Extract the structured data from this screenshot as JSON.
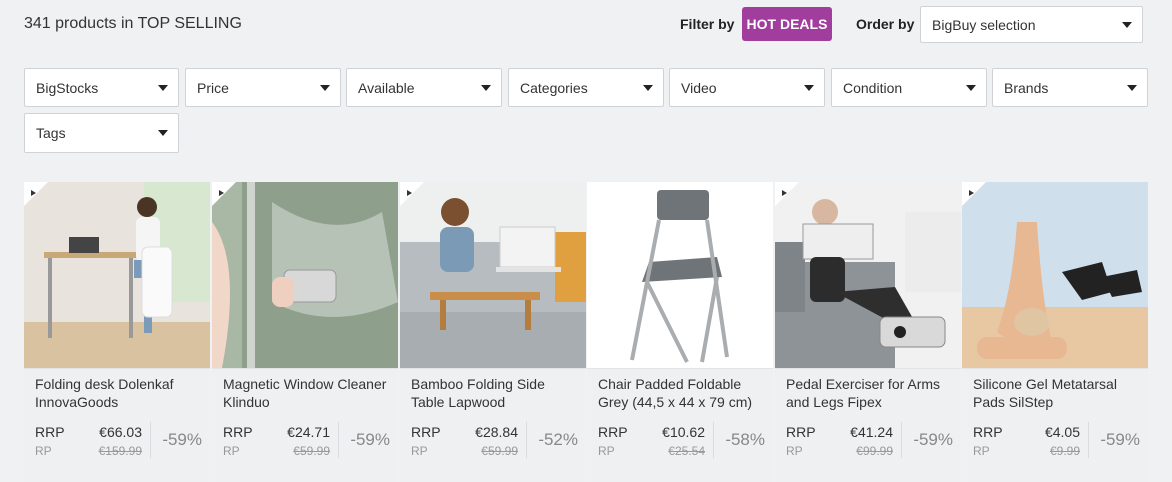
{
  "header": {
    "count_title": "341 products in TOP SELLING",
    "filter_by_label": "Filter by",
    "hot_deals_label": "HOT DEALS",
    "order_by_label": "Order by",
    "order_by_value": "BigBuy selection"
  },
  "filters": [
    {
      "label": "BigStocks"
    },
    {
      "label": "Price"
    },
    {
      "label": "Available"
    },
    {
      "label": "Categories"
    },
    {
      "label": "Video"
    },
    {
      "label": "Condition"
    },
    {
      "label": "Brands"
    },
    {
      "label": "Tags"
    }
  ],
  "colors": {
    "accent": "#a13d9d",
    "background": "#f0f1f3"
  },
  "products": [
    {
      "name": "Folding desk Dolenkaf InnovaGoods",
      "rrp_label": "RRP",
      "rp_label": "RP",
      "price": "€66.03",
      "old_price": "€159.99",
      "discount": "-59%"
    },
    {
      "name": "Magnetic Window Cleaner Klinduo",
      "rrp_label": "RRP",
      "rp_label": "RP",
      "price": "€24.71",
      "old_price": "€59.99",
      "discount": "-59%"
    },
    {
      "name": "Bamboo Folding Side Table Lapwood",
      "rrp_label": "RRP",
      "rp_label": "RP",
      "price": "€28.84",
      "old_price": "€59.99",
      "discount": "-52%"
    },
    {
      "name": "Chair Padded Foldable Grey (44,5 x 44 x 79 cm)",
      "rrp_label": "RRP",
      "rp_label": "RP",
      "price": "€10.62",
      "old_price": "€25.54",
      "discount": "-58%"
    },
    {
      "name": "Pedal Exerciser for Arms and Legs Fipex",
      "rrp_label": "RRP",
      "rp_label": "RP",
      "price": "€41.24",
      "old_price": "€99.99",
      "discount": "-59%"
    },
    {
      "name": "Silicone Gel Metatarsal Pads SilStep",
      "rrp_label": "RRP",
      "rp_label": "RP",
      "price": "€4.05",
      "old_price": "€9.99",
      "discount": "-59%"
    }
  ]
}
